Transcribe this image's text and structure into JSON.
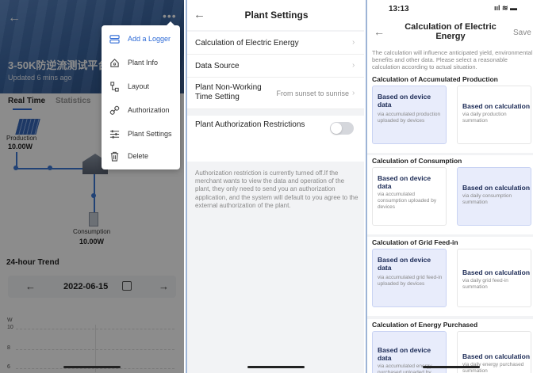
{
  "colors": {
    "accent": "#2d6ad6",
    "selected_card": "#e8ecfb",
    "toggle_off": "#d5d7dc"
  },
  "panel1": {
    "plant_title": "3-50K防逆流测试平台",
    "updated": "Updated 6 mins ago",
    "tabs": [
      "Real Time",
      "Statistics"
    ],
    "production_label": "Production",
    "production_value": "10.00W",
    "consumption_label": "Consumption",
    "consumption_value": "10.00W",
    "trend_title": "24-hour Trend",
    "date": "2022-06-15",
    "prev_arrow": "←",
    "next_arrow": "→",
    "back_arrow": "←",
    "more_dots": "•••",
    "y_unit": "W",
    "y_ticks": [
      "10",
      "8",
      "6"
    ],
    "menu": [
      {
        "label": "Add a Logger",
        "icon": "logger-icon"
      },
      {
        "label": "Plant Info",
        "icon": "home-icon"
      },
      {
        "label": "Layout",
        "icon": "layout-icon"
      },
      {
        "label": "Authorization",
        "icon": "link-icon"
      },
      {
        "label": "Plant Settings",
        "icon": "settings-list-icon"
      },
      {
        "label": "Delete",
        "icon": "trash-icon"
      }
    ]
  },
  "panel2": {
    "back_arrow": "←",
    "title": "Plant Settings",
    "rows": [
      {
        "label": "Calculation of Electric Energy",
        "chevron": "›"
      },
      {
        "label": "Data Source",
        "chevron": "›"
      },
      {
        "label": "Plant Non-Working Time Setting",
        "value": "From sunset to sunrise",
        "chevron": "›"
      }
    ],
    "auth_label": "Plant Authorization Restrictions",
    "auth_note": "Authorization restriction is currently turned off.If the merchant wants to view the data and operation of the plant, they only need to send you an authorization application, and the system will default to you agree to the external authorization of the plant."
  },
  "panel3": {
    "time": "13:13",
    "status_icons": "ııl ≋ ▬",
    "back_arrow": "←",
    "title": "Calculation of Electric Energy",
    "save": "Save",
    "intro": "The calculation will influence anticipated yield, environmental benefits and other data. Please select a reasonable calculation according to actual situation.",
    "sections": [
      {
        "title": "Calculation of Accumulated Production",
        "options": [
          {
            "title": "Based on device data",
            "desc": "via accumulated production uploaded by devices",
            "selected": true
          },
          {
            "title": "Based on calculation",
            "desc": "via daily production summation",
            "selected": false
          }
        ]
      },
      {
        "title": "Calculation of Consumption",
        "options": [
          {
            "title": "Based on device data",
            "desc": "via accumulated consumption uploaded by devices",
            "selected": false
          },
          {
            "title": "Based on calculation",
            "desc": "via daily consumption summation",
            "selected": true
          }
        ]
      },
      {
        "title": "Calculation of Grid Feed-in",
        "options": [
          {
            "title": "Based on device data",
            "desc": "via accumulated grid feed-in uploaded by devices",
            "selected": true
          },
          {
            "title": "Based on calculation",
            "desc": "via daily grid feed-in summation",
            "selected": false
          }
        ]
      },
      {
        "title": "Calculation of Energy Purchased",
        "options": [
          {
            "title": "Based on device data",
            "desc": "via accumulated energy purchased uploaded by",
            "selected": true
          },
          {
            "title": "Based on calculation",
            "desc": "via daily energy purchased summation",
            "selected": false
          }
        ]
      }
    ]
  }
}
